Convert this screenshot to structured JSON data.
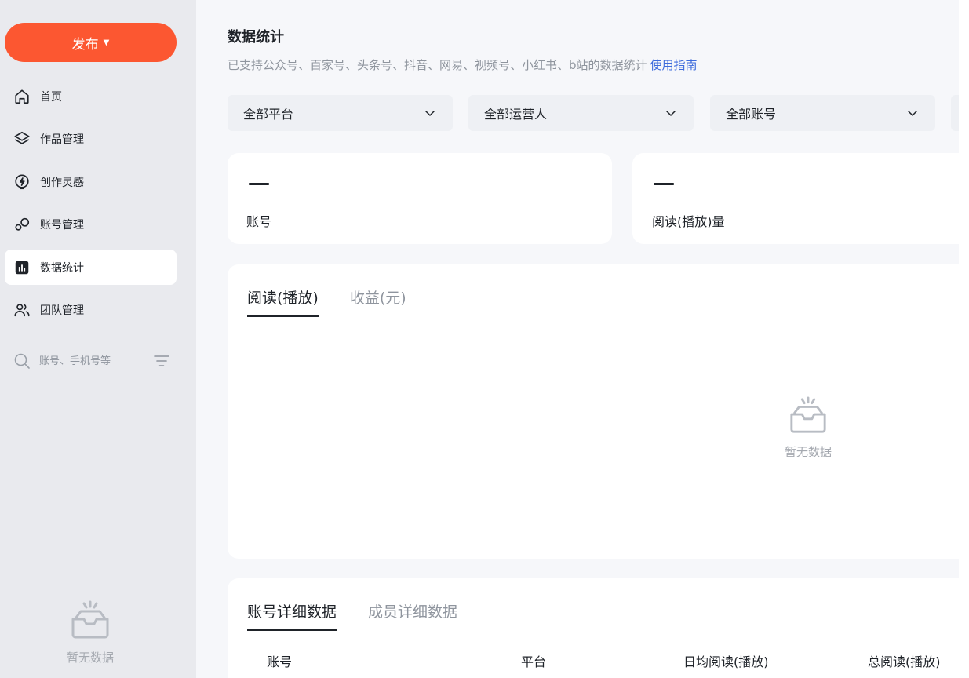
{
  "sidebar": {
    "publish_label": "发布",
    "caret": "▼",
    "nav": [
      {
        "label": "首页",
        "icon": "home-icon"
      },
      {
        "label": "作品管理",
        "icon": "layers-icon"
      },
      {
        "label": "创作灵感",
        "icon": "lightning-icon"
      },
      {
        "label": "账号管理",
        "icon": "account-circles-icon"
      },
      {
        "label": "数据统计",
        "icon": "bar-chart-icon",
        "active": true
      },
      {
        "label": "团队管理",
        "icon": "team-icon"
      }
    ],
    "search_placeholder": "账号、手机号等",
    "empty_text": "暂无数据"
  },
  "main": {
    "title": "数据统计",
    "subtitle": "已支持公众号、百家号、头条号、抖音、网易、视频号、小红书、b站的数据统计",
    "guide_link": "使用指南",
    "filters": [
      "全部平台",
      "全部运营人",
      "全部账号"
    ],
    "stats": [
      {
        "label": "账号"
      },
      {
        "label": "阅读(播放)量"
      }
    ],
    "chart_tabs": [
      "阅读(播放)",
      "收益(元)"
    ],
    "chart_empty_text": "暂无数据",
    "detail_tabs": [
      "账号详细数据",
      "成员详细数据"
    ],
    "table_headers": [
      "账号",
      "平台",
      "日均阅读(播放)",
      "总阅读(播放)"
    ]
  },
  "colors": {
    "accent": "#fc5731",
    "link": "#3d6bdc",
    "sidebar_bg": "#e9eaee",
    "page_bg": "#f6f7fa"
  }
}
